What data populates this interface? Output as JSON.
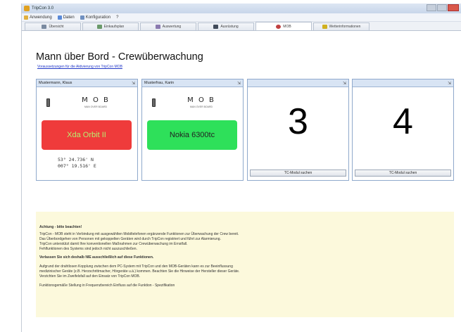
{
  "window": {
    "title": "TripCon 3.0"
  },
  "menu": [
    {
      "label": "Anwendung",
      "icon": "folder-icon",
      "color": "#e0b040"
    },
    {
      "label": "Daten",
      "icon": "users-icon",
      "color": "#5a8ad8"
    },
    {
      "label": "Konfiguration",
      "icon": "gear-icon",
      "color": "#7090c0"
    },
    {
      "label": "?",
      "icon": "",
      "color": ""
    }
  ],
  "tabs": [
    {
      "label": "Übersicht",
      "icon": "overview-icon",
      "color": "#7a8aa0"
    },
    {
      "label": "Einkaufsplan",
      "icon": "plan-icon",
      "color": "#6a9a6a"
    },
    {
      "label": "Auswertung",
      "icon": "chart-icon",
      "color": "#8a7ab0"
    },
    {
      "label": "Ausrüstung",
      "icon": "equipment-icon",
      "color": "#404a5a"
    },
    {
      "label": "MOB",
      "icon": "mob-icon",
      "color": "#c04040",
      "active": true
    },
    {
      "label": "Wetterinformationen",
      "icon": "weather-icon",
      "color": "#d0b020"
    }
  ],
  "page": {
    "title": "Mann über Bord - Crewüberwachung",
    "link": "Voraussetzungen für die Aktivierung von TripCon MOB"
  },
  "panels": [
    {
      "header": "Mustermann, Klaus",
      "mob_label": "M O B",
      "mob_sub": "MAN OVER BOARD",
      "device": "Xda Orbit II",
      "device_color": "red",
      "coords": "53° 24.736' N\n007° 19.516' E"
    },
    {
      "header": "Musterfrau, Karin",
      "mob_label": "M O B",
      "mob_sub": "MAN OVER BOARD",
      "device": "Nokia 6300tc",
      "device_color": "green"
    }
  ],
  "slots": [
    {
      "number": "3",
      "button": "TC-Modul suchen"
    },
    {
      "number": "4",
      "button": "TC-Modul suchen"
    }
  ],
  "notice": {
    "heading": "Achtung - bitte beachten!",
    "lines": [
      "TripCon - MOB steht in Verbindung mit ausgewählten Mobiltelefonen ergänzende Funktionen zur Überwachung der Crew bereit.",
      "Das Überbordgehen von Personen mit gekoppelten Geräten wird durch TripCon registriert und führt zur Alarmierung.",
      "TripCon unterstützt damit Ihre konventionellen Maßnahmen zur Crewüberwachung im Ernstfall.",
      "Fehlfunktionen des Systems sind jedoch nicht auszuschließen."
    ],
    "warning": "Verlassen Sie sich deshalb NIE ausschließlich auf diese Funktionen.",
    "lines2": [
      "Aufgrund der drahtlosen Kopplung zwischen dem PC-System mit TripCon und den MOB-Geräten kann es zur Beeinflussung",
      "medizinischer Geräte (z.B. Herzschrittmacher, Hörgeräte u.ä.) kommen. Beachten Sie die Hinweise der Hersteller dieser Geräte.",
      "Verzichten Sie im Zweifelsfall auf den Einsatz von TripCon MOB."
    ],
    "footer": "Funktionsgemäße Stellung in Frequenzbereich Einfluss auf die Funktion - Spezifikation"
  }
}
